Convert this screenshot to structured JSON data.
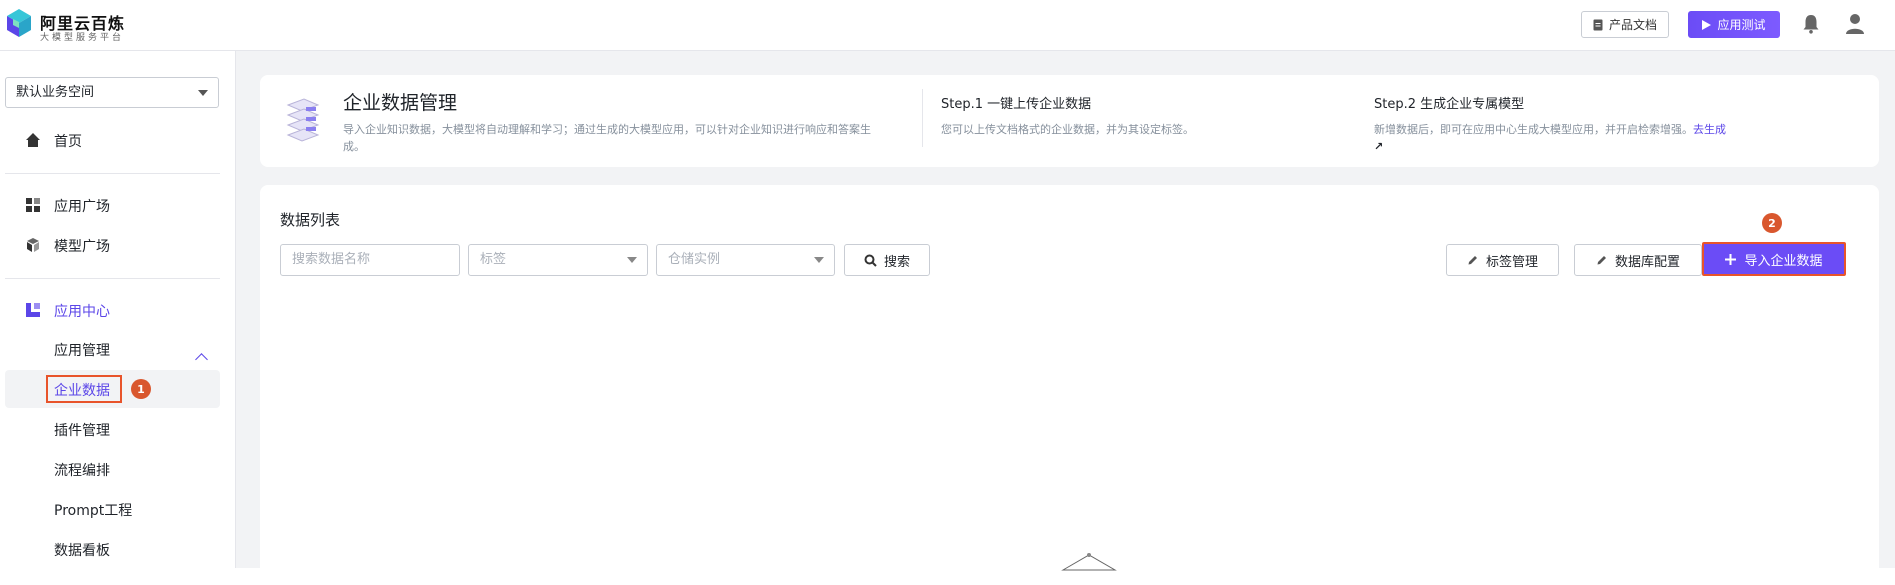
{
  "header": {
    "brand": "阿里云百炼",
    "brand_sub": "大模型服务平台",
    "docs_label": "产品文档",
    "test_label": "应用测试",
    "icons": [
      "logo-icon",
      "document-icon",
      "play-icon",
      "bell-icon",
      "user-icon"
    ]
  },
  "sidebar": {
    "workspace": "默认业务空间",
    "home": "首页",
    "app_plaza": "应用广场",
    "model_plaza": "模型广场",
    "app_center": "应用中心",
    "sub_items": [
      "应用管理",
      "企业数据",
      "插件管理",
      "流程编排",
      "Prompt工程",
      "数据看板"
    ],
    "active_sub": "企业数据",
    "badge_1": "1"
  },
  "intro": {
    "title": "企业数据管理",
    "desc": "导入企业知识数据，大模型将自动理解和学习；通过生成的大模型应用，可以针对企业知识进行响应和答案生成。",
    "step1_title": "Step.1 一键上传企业数据",
    "step1_desc": "您可以上传文档格式的企业数据，并为其设定标签。",
    "step2_title": "Step.2 生成企业专属模型",
    "step2_desc": "新增数据后，即可在应用中心生成大模型应用，并开启检索增强。",
    "step2_link": "去生成",
    "step2_arrow": "↗"
  },
  "list": {
    "title": "数据列表",
    "search_placeholder": "搜索数据名称",
    "tag_placeholder": "标签",
    "storage_placeholder": "仓储实例",
    "search_btn": "搜索",
    "tag_manage": "标签管理",
    "db_config": "数据库配置",
    "import_btn": "导入企业数据",
    "badge_2": "2"
  },
  "colors": {
    "accent": "#6b4cf6",
    "highlight": "#e8542b",
    "badge": "#d9572e"
  }
}
